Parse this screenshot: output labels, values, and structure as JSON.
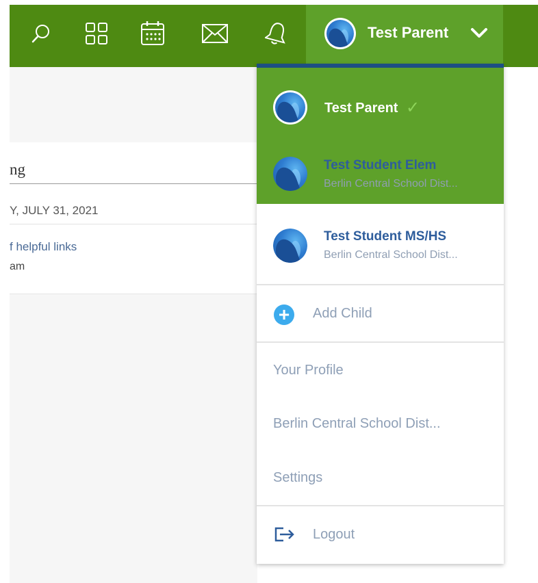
{
  "topbar": {
    "icons": [
      "search-icon",
      "apps-grid-icon",
      "calendar-icon",
      "mail-icon",
      "bell-icon"
    ],
    "user_name": "Test Parent",
    "chevron": "chevron-down-icon"
  },
  "background_card": {
    "heading": "ng",
    "date": "Y, JULY 31, 2021",
    "link": "f helpful links",
    "time": "am"
  },
  "dropdown": {
    "active_user": "Test Parent",
    "students": [
      {
        "name": "Test Student Elem",
        "district": "Berlin Central School Dist..."
      },
      {
        "name": "Test Student MS/HS",
        "district": "Berlin Central School Dist..."
      }
    ],
    "add_child": "Add Child",
    "menu_items": [
      "Your Profile",
      "Berlin Central School Dist...",
      "Settings"
    ],
    "logout": "Logout"
  },
  "colors": {
    "topbar": "#4e8a12",
    "active": "#5ea12a",
    "accent_navy": "#1d4f83",
    "link_blue": "#2e5d9c",
    "muted_text": "#8e9fb6",
    "add_icon": "#3cabed"
  }
}
